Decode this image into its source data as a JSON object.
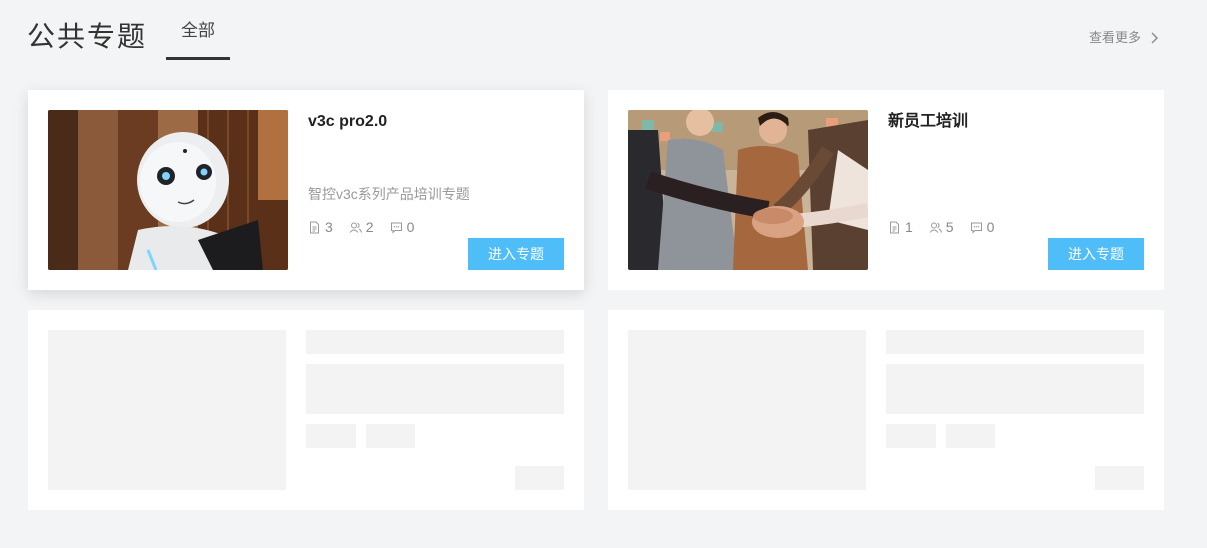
{
  "header": {
    "title": "公共专题",
    "tab_all": "全部",
    "see_more": "查看更多"
  },
  "topics": [
    {
      "title": "v3c pro2.0",
      "description": "智控v3c系列产品培训专题",
      "documents": "3",
      "members": "2",
      "comments": "0",
      "enter_label": "进入专题",
      "image": "robot-photo"
    },
    {
      "title": "新员工培训",
      "description": "",
      "documents": "1",
      "members": "5",
      "comments": "0",
      "enter_label": "进入专题",
      "image": "team-hands-photo"
    }
  ],
  "icons": {
    "document": "document-icon",
    "members": "members-icon",
    "comments": "comment-icon",
    "chevron": "chevron-right-icon"
  },
  "colors": {
    "accent": "#4fbdf7",
    "background": "#f3f4f6",
    "skeleton": "#f3f3f3"
  }
}
